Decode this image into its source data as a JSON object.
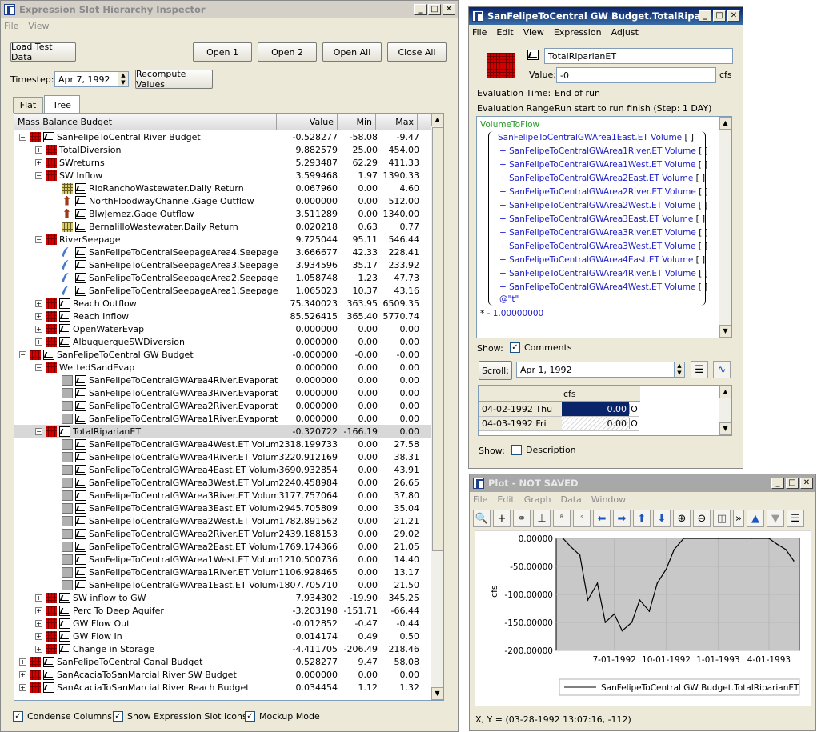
{
  "inspector": {
    "title": "Expression Slot Hierarchy Inspector",
    "menu": [
      "File",
      "View"
    ],
    "buttons": {
      "load": "Load Test Data",
      "open1": "Open 1",
      "open2": "Open 2",
      "openAll": "Open All",
      "closeAll": "Close All",
      "recompute": "Recompute Values"
    },
    "timestep_label": "Timestep:",
    "timestep_value": "Apr 7, 1992",
    "tabs": [
      "Flat",
      "Tree"
    ],
    "columns": [
      "Mass Balance Budget",
      "Value",
      "Min",
      "Max"
    ],
    "rows": [
      {
        "d": 0,
        "exp": "-",
        "icons": [
          "rb",
          "ex"
        ],
        "name": "SanFelipeToCentral River Budget",
        "v": "-0.528277",
        "mn": "-58.08",
        "mx": "-9.47"
      },
      {
        "d": 1,
        "exp": "+",
        "icons": [
          "rb"
        ],
        "name": "TotalDiversion",
        "v": "9.882579",
        "mn": "25.00",
        "mx": "454.00"
      },
      {
        "d": 1,
        "exp": "+",
        "icons": [
          "rb"
        ],
        "name": "SWreturns",
        "v": "5.293487",
        "mn": "62.29",
        "mx": "411.33"
      },
      {
        "d": 1,
        "exp": "-",
        "icons": [
          "rb"
        ],
        "name": "SW Inflow",
        "v": "3.599468",
        "mn": "1.97",
        "mx": "1390.33"
      },
      {
        "d": 2,
        "exp": "",
        "icons": [
          "grid",
          "ex"
        ],
        "name": "RioRanchoWastewater.Daily Return",
        "v": "0.067960",
        "mn": "0.00",
        "mx": "4.60"
      },
      {
        "d": 2,
        "exp": "",
        "icons": [
          "gage",
          "ex"
        ],
        "name": "NorthFloodwayChannel.Gage Outflow",
        "v": "0.000000",
        "mn": "0.00",
        "mx": "512.00"
      },
      {
        "d": 2,
        "exp": "",
        "icons": [
          "gage",
          "ex"
        ],
        "name": "BlwJemez.Gage Outflow",
        "v": "3.511289",
        "mn": "0.00",
        "mx": "1340.00"
      },
      {
        "d": 2,
        "exp": "",
        "icons": [
          "grid",
          "ex"
        ],
        "name": "BernalilloWastewater.Daily Return",
        "v": "0.020218",
        "mn": "0.63",
        "mx": "0.77"
      },
      {
        "d": 1,
        "exp": "-",
        "icons": [
          "rb"
        ],
        "name": "RiverSeepage",
        "v": "9.725044",
        "mn": "95.11",
        "mx": "546.44"
      },
      {
        "d": 2,
        "exp": "",
        "icons": [
          "seep",
          "ex"
        ],
        "name": "SanFelipeToCentralSeepageArea4.Seepage",
        "v": "3.666677",
        "mn": "42.33",
        "mx": "228.41"
      },
      {
        "d": 2,
        "exp": "",
        "icons": [
          "seep",
          "ex"
        ],
        "name": "SanFelipeToCentralSeepageArea3.Seepage",
        "v": "3.934596",
        "mn": "35.17",
        "mx": "233.92"
      },
      {
        "d": 2,
        "exp": "",
        "icons": [
          "seep",
          "ex"
        ],
        "name": "SanFelipeToCentralSeepageArea2.Seepage",
        "v": "1.058748",
        "mn": "1.23",
        "mx": "47.73"
      },
      {
        "d": 2,
        "exp": "",
        "icons": [
          "seep",
          "ex"
        ],
        "name": "SanFelipeToCentralSeepageArea1.Seepage",
        "v": "1.065023",
        "mn": "10.37",
        "mx": "43.16"
      },
      {
        "d": 1,
        "exp": "+",
        "icons": [
          "rb",
          "ex"
        ],
        "name": "Reach Outflow",
        "v": "75.340023",
        "mn": "363.95",
        "mx": "6509.35"
      },
      {
        "d": 1,
        "exp": "+",
        "icons": [
          "rb",
          "ex"
        ],
        "name": "Reach Inflow",
        "v": "85.526415",
        "mn": "365.40",
        "mx": "5770.74"
      },
      {
        "d": 1,
        "exp": "+",
        "icons": [
          "rb",
          "ex"
        ],
        "name": "OpenWaterEvap",
        "v": "0.000000",
        "mn": "0.00",
        "mx": "0.00"
      },
      {
        "d": 1,
        "exp": "+",
        "icons": [
          "rb",
          "ex"
        ],
        "name": "AlbuquerqueSWDiversion",
        "v": "0.000000",
        "mn": "0.00",
        "mx": "0.00"
      },
      {
        "d": 0,
        "exp": "-",
        "icons": [
          "rb",
          "ex"
        ],
        "name": "SanFelipeToCentral GW Budget",
        "v": "-0.000000",
        "mn": "-0.00",
        "mx": "-0.00"
      },
      {
        "d": 1,
        "exp": "-",
        "icons": [
          "rb"
        ],
        "name": "WettedSandEvap",
        "v": "0.000000",
        "mn": "0.00",
        "mx": "0.00"
      },
      {
        "d": 2,
        "exp": "",
        "icons": [
          "area",
          "ex"
        ],
        "name": "SanFelipeToCentralGWArea4River.Evaporation",
        "v": "0.000000",
        "mn": "0.00",
        "mx": "0.00"
      },
      {
        "d": 2,
        "exp": "",
        "icons": [
          "area",
          "ex"
        ],
        "name": "SanFelipeToCentralGWArea3River.Evaporation",
        "v": "0.000000",
        "mn": "0.00",
        "mx": "0.00"
      },
      {
        "d": 2,
        "exp": "",
        "icons": [
          "area",
          "ex"
        ],
        "name": "SanFelipeToCentralGWArea2River.Evaporation",
        "v": "0.000000",
        "mn": "0.00",
        "mx": "0.00"
      },
      {
        "d": 2,
        "exp": "",
        "icons": [
          "area",
          "ex"
        ],
        "name": "SanFelipeToCentralGWArea1River.Evaporation",
        "v": "0.000000",
        "mn": "0.00",
        "mx": "0.00"
      },
      {
        "d": 1,
        "exp": "-",
        "icons": [
          "rb",
          "ex"
        ],
        "name": "TotalRiparianET",
        "v": "-0.320722",
        "mn": "-166.19",
        "mx": "0.00",
        "sel": true
      },
      {
        "d": 2,
        "exp": "",
        "icons": [
          "area",
          "ex"
        ],
        "name": "SanFelipeToCentralGWArea4West.ET Volume",
        "v": "2318.199733",
        "mn": "0.00",
        "mx": "27.58"
      },
      {
        "d": 2,
        "exp": "",
        "icons": [
          "area",
          "ex"
        ],
        "name": "SanFelipeToCentralGWArea4River.ET Volume",
        "v": "3220.912169",
        "mn": "0.00",
        "mx": "38.31"
      },
      {
        "d": 2,
        "exp": "",
        "icons": [
          "area",
          "ex"
        ],
        "name": "SanFelipeToCentralGWArea4East.ET Volume",
        "v": "3690.932854",
        "mn": "0.00",
        "mx": "43.91"
      },
      {
        "d": 2,
        "exp": "",
        "icons": [
          "area",
          "ex"
        ],
        "name": "SanFelipeToCentralGWArea3West.ET Volume",
        "v": "2240.458984",
        "mn": "0.00",
        "mx": "26.65"
      },
      {
        "d": 2,
        "exp": "",
        "icons": [
          "area",
          "ex"
        ],
        "name": "SanFelipeToCentralGWArea3River.ET Volume",
        "v": "3177.757064",
        "mn": "0.00",
        "mx": "37.80"
      },
      {
        "d": 2,
        "exp": "",
        "icons": [
          "area",
          "ex"
        ],
        "name": "SanFelipeToCentralGWArea3East.ET Volume",
        "v": "2945.705809",
        "mn": "0.00",
        "mx": "35.04"
      },
      {
        "d": 2,
        "exp": "",
        "icons": [
          "area",
          "ex"
        ],
        "name": "SanFelipeToCentralGWArea2West.ET Volume",
        "v": "1782.891562",
        "mn": "0.00",
        "mx": "21.21"
      },
      {
        "d": 2,
        "exp": "",
        "icons": [
          "area",
          "ex"
        ],
        "name": "SanFelipeToCentralGWArea2River.ET Volume",
        "v": "2439.188153",
        "mn": "0.00",
        "mx": "29.02"
      },
      {
        "d": 2,
        "exp": "",
        "icons": [
          "area",
          "ex"
        ],
        "name": "SanFelipeToCentralGWArea2East.ET Volume",
        "v": "1769.174366",
        "mn": "0.00",
        "mx": "21.05"
      },
      {
        "d": 2,
        "exp": "",
        "icons": [
          "area",
          "ex"
        ],
        "name": "SanFelipeToCentralGWArea1West.ET Volume",
        "v": "1210.500736",
        "mn": "0.00",
        "mx": "14.40"
      },
      {
        "d": 2,
        "exp": "",
        "icons": [
          "area",
          "ex"
        ],
        "name": "SanFelipeToCentralGWArea1River.ET Volume",
        "v": "1106.928465",
        "mn": "0.00",
        "mx": "13.17"
      },
      {
        "d": 2,
        "exp": "",
        "icons": [
          "area",
          "ex"
        ],
        "name": "SanFelipeToCentralGWArea1East.ET Volume",
        "v": "1807.705710",
        "mn": "0.00",
        "mx": "21.50"
      },
      {
        "d": 1,
        "exp": "+",
        "icons": [
          "rb",
          "ex"
        ],
        "name": "SW inflow to GW",
        "v": "7.934302",
        "mn": "-19.90",
        "mx": "345.25"
      },
      {
        "d": 1,
        "exp": "+",
        "icons": [
          "rb",
          "ex"
        ],
        "name": "Perc To Deep Aquifer",
        "v": "-3.203198",
        "mn": "-151.71",
        "mx": "-66.44"
      },
      {
        "d": 1,
        "exp": "+",
        "icons": [
          "rb",
          "ex"
        ],
        "name": "GW Flow Out",
        "v": "-0.012852",
        "mn": "-0.47",
        "mx": "-0.44"
      },
      {
        "d": 1,
        "exp": "+",
        "icons": [
          "rb",
          "ex"
        ],
        "name": "GW Flow In",
        "v": "0.014174",
        "mn": "0.49",
        "mx": "0.50"
      },
      {
        "d": 1,
        "exp": "+",
        "icons": [
          "rb",
          "ex"
        ],
        "name": "Change in Storage",
        "v": "-4.411705",
        "mn": "-206.49",
        "mx": "218.46"
      },
      {
        "d": 0,
        "exp": "+",
        "icons": [
          "rb",
          "ex"
        ],
        "name": "SanFelipeToCentral Canal Budget",
        "v": "0.528277",
        "mn": "9.47",
        "mx": "58.08"
      },
      {
        "d": 0,
        "exp": "+",
        "icons": [
          "rb",
          "ex"
        ],
        "name": "SanAcaciaToSanMarcial River SW Budget",
        "v": "0.000000",
        "mn": "0.00",
        "mx": "0.00"
      },
      {
        "d": 0,
        "exp": "+",
        "icons": [
          "rb",
          "ex"
        ],
        "name": "SanAcaciaToSanMarcial River Reach Budget",
        "v": "0.034454",
        "mn": "1.12",
        "mx": "1.32"
      }
    ],
    "checks": [
      {
        "label": "Condense Columns",
        "on": true
      },
      {
        "label": "Show Expression Slot Icons",
        "on": true
      },
      {
        "label": "Mockup Mode",
        "on": true
      }
    ]
  },
  "slot": {
    "title": "SanFelipeToCentral GW Budget.TotalRiparian...",
    "menu": [
      "File",
      "Edit",
      "View",
      "Expression",
      "Adjust"
    ],
    "name": "TotalRiparianET",
    "value_label": "Value:",
    "value": "-0",
    "units": "cfs",
    "eval_time_label": "Evaluation Time:",
    "eval_time": "End of run",
    "eval_range_label": "Evaluation Range:",
    "eval_range": "Run start to run finish (Step: 1 DAY)",
    "expr_func": "VolumeToFlow",
    "expr_lines": [
      "SanFelipeToCentralGWArea1East.ET Volume",
      "+ SanFelipeToCentralGWArea1River.ET Volume",
      "+ SanFelipeToCentralGWArea1West.ET Volume",
      "+ SanFelipeToCentralGWArea2East.ET Volume",
      "+ SanFelipeToCentralGWArea2River.ET Volume",
      "+ SanFelipeToCentralGWArea2West.ET Volume",
      "+ SanFelipeToCentralGWArea3East.ET Volume",
      "+ SanFelipeToCentralGWArea3River.ET Volume",
      "+ SanFelipeToCentralGWArea3West.ET Volume",
      "+ SanFelipeToCentralGWArea4East.ET Volume",
      "+ SanFelipeToCentralGWArea4River.ET Volume",
      "+ SanFelipeToCentralGWArea4West.ET Volume"
    ],
    "expr_at": "@\"t\"",
    "expr_mult_prefix": "* - ",
    "expr_mult_value": "1.00000000",
    "show_label": "Show:",
    "comments_label": "Comments",
    "scroll_label": "Scroll:",
    "scroll_date": "Apr 1, 1992",
    "table_header": "cfs",
    "table_rows": [
      {
        "date": "04-02-1992 Thu",
        "val": "0.00",
        "flag": "O"
      },
      {
        "date": "04-03-1992 Fri",
        "val": "0.00",
        "flag": "O"
      }
    ],
    "description_label": "Description"
  },
  "plot": {
    "title": "Plot - NOT SAVED",
    "menu": [
      "File",
      "Edit",
      "Graph",
      "Data",
      "Window"
    ],
    "ylabel": "cfs",
    "yticks": [
      "0.00000",
      "-50.00000",
      "-100.00000",
      "-150.00000",
      "-200.00000"
    ],
    "xticks": [
      "7-01-1992",
      "10-01-1992",
      "1-01-1993",
      "4-01-1993"
    ],
    "legend": "SanFelipeToCentral GW Budget.TotalRiparianET",
    "status": "X, Y = (03-28-1992 13:07:16, -112)"
  },
  "chart_data": {
    "type": "line",
    "xlabel": "",
    "ylabel": "cfs",
    "ylim": [
      -200,
      0
    ],
    "x": [
      "1992-04-01",
      "1992-04-15",
      "1992-05-01",
      "1992-05-15",
      "1992-06-01",
      "1992-06-15",
      "1992-07-01",
      "1992-07-15",
      "1992-08-01",
      "1992-08-15",
      "1992-09-01",
      "1992-09-15",
      "1992-10-01",
      "1992-10-15",
      "1992-11-01",
      "1993-01-01",
      "1993-03-01",
      "1993-04-01",
      "1993-04-15",
      "1993-05-01",
      "1993-05-15"
    ],
    "series": [
      {
        "name": "SanFelipeToCentral GW Budget.TotalRiparianET",
        "values": [
          0,
          -15,
          -30,
          -110,
          -80,
          -150,
          -135,
          -165,
          -150,
          -110,
          -130,
          -80,
          -55,
          -20,
          0,
          0,
          0,
          0,
          -10,
          -20,
          -40
        ]
      }
    ]
  }
}
